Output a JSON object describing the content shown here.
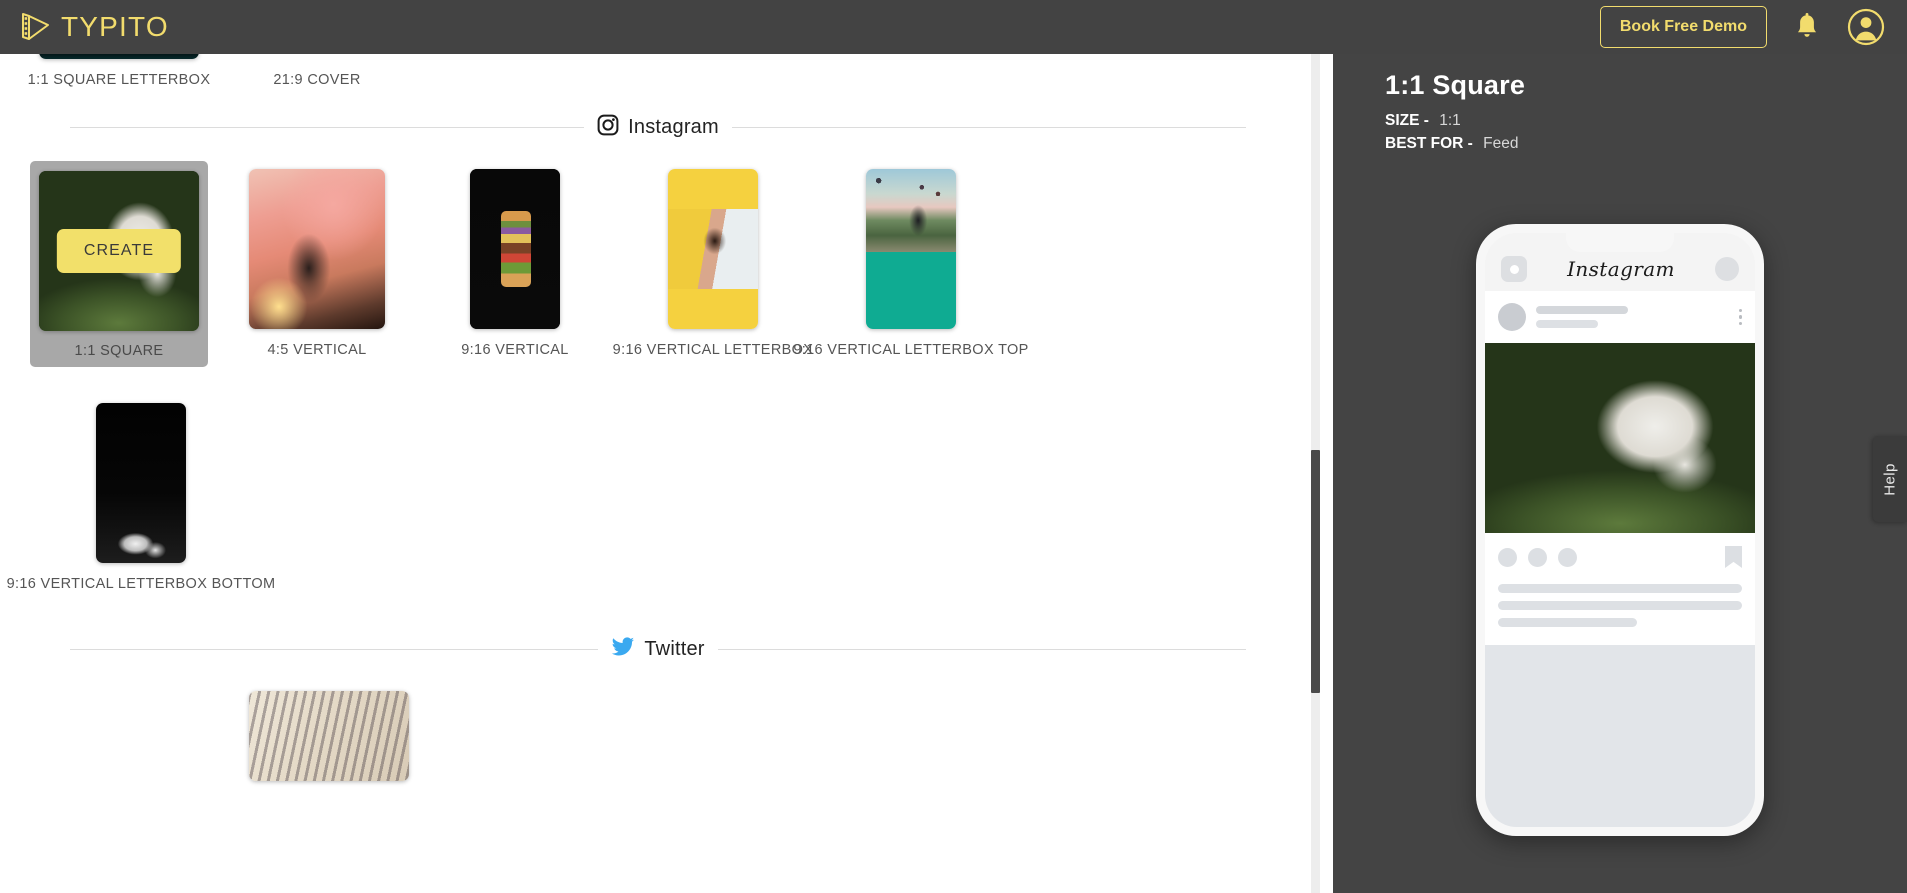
{
  "header": {
    "logo_text": "TYPITO",
    "logo_icon": "film-play-icon",
    "demo_button": "Book Free Demo",
    "bell_icon": "bell-icon",
    "avatar_icon": "user-avatar-icon",
    "accent_color": "#f2dc6d",
    "background_color": "#434343"
  },
  "main": {
    "partial_row": {
      "cards": [
        {
          "label": "1:1 SQUARE LETTERBOX",
          "thumb": "letterbox-black"
        },
        {
          "label": "21:9 COVER",
          "thumb": "none"
        }
      ]
    },
    "sections": [
      {
        "name": "instagram",
        "title": "Instagram",
        "icon": "instagram-camera-icon",
        "icon_color": "#1b1b1b",
        "rows": [
          {
            "cards": [
              {
                "label": "1:1 SQUARE",
                "shape": "sq",
                "thumb": "dog",
                "selected": true,
                "create_button": "CREATE"
              },
              {
                "label": "4:5 VERTICAL",
                "shape": "v45",
                "thumb": "concert",
                "selected": false
              },
              {
                "label": "9:16 VERTICAL",
                "shape": "v916",
                "thumb": "burger",
                "selected": false
              },
              {
                "label": "9:16 VERTICAL LETTERBOX",
                "shape": "v916",
                "thumb": "runner",
                "letterbox": "both",
                "letterbox_color": "#f5d13f",
                "selected": false
              },
              {
                "label": "9:16 VERTICAL LETTERBOX TOP",
                "shape": "v916",
                "thumb": "balloon",
                "letterbox": "bottom",
                "letterbox_color": "#0fab92",
                "selected": false
              }
            ]
          },
          {
            "cards": [
              {
                "label": "9:16 VERTICAL LETTERBOX BOTTOM",
                "shape": "v916",
                "thumb": "shoes",
                "selected": false
              }
            ]
          }
        ]
      },
      {
        "name": "twitter",
        "title": "Twitter",
        "icon": "twitter-bird-icon",
        "icon_color": "#3aa9f0",
        "rows": [
          {
            "cards": [
              {
                "label": "",
                "shape": "sq",
                "thumb": "newspaper",
                "selected": false
              }
            ]
          }
        ]
      }
    ],
    "scrollbar": {
      "name": "vertical-scrollbar",
      "thumb_color": "#4a4a4a"
    }
  },
  "right_panel": {
    "title": "1:1 Square",
    "size_key": "SIZE -",
    "size_value": "1:1",
    "best_for_key": "BEST FOR -",
    "best_for_value": "Feed",
    "background_color": "#444444",
    "preview": {
      "platform_logo": "Instagram",
      "camera_icon": "instagram-camera-icon",
      "menu_icon": "more-options-icon",
      "bookmark_icon": "bookmark-icon",
      "post_image": "dog"
    }
  },
  "help_tab": {
    "label": "Help"
  }
}
